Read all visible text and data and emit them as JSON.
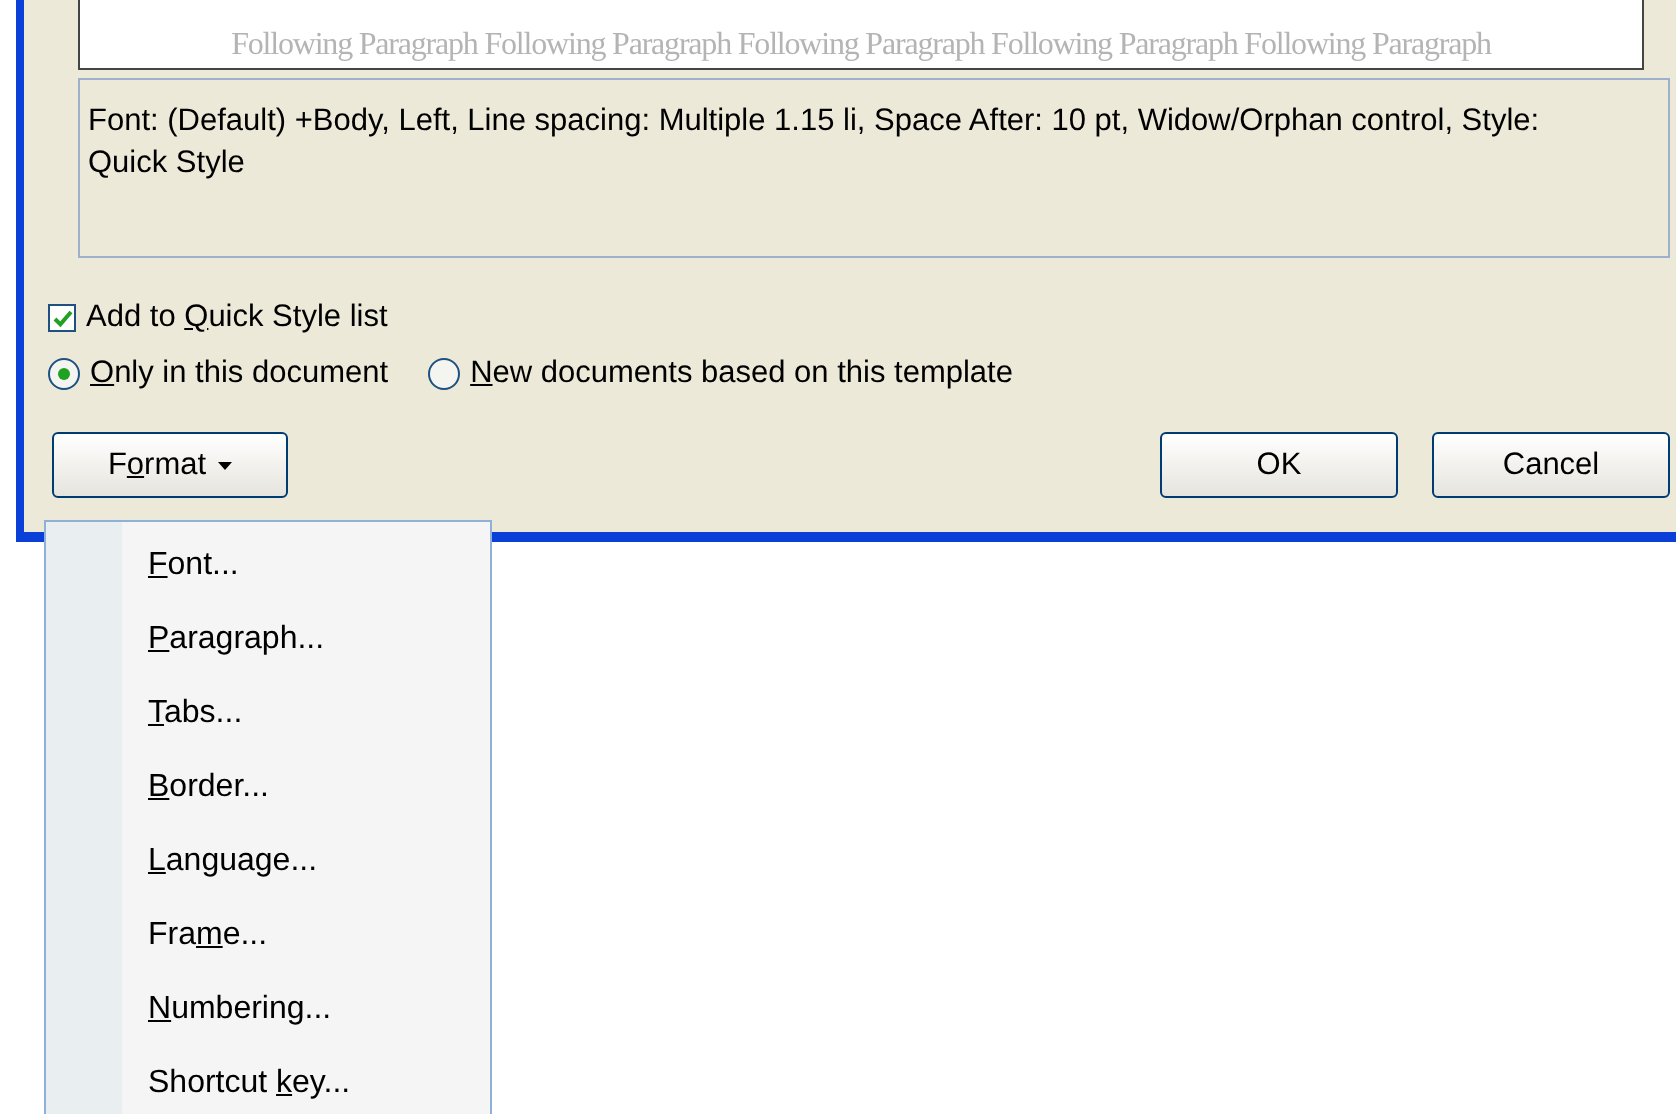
{
  "preview": {
    "following_text": "Following Paragraph Following Paragraph Following Paragraph Following Paragraph Following Paragraph"
  },
  "description": "Font: (Default) +Body, Left, Line spacing:  Multiple 1.15 li, Space After:  10 pt, Widow/Orphan control, Style: Quick Style",
  "add_to_quick_style": {
    "pre": "Add to ",
    "key": "Q",
    "post": "uick Style list",
    "checked": true
  },
  "scope_options": [
    {
      "key": "O",
      "post": "nly in this document",
      "selected": true
    },
    {
      "key": "N",
      "post": "ew documents based on this template",
      "selected": false
    }
  ],
  "format_button": {
    "pre": "F",
    "key": "o",
    "post": "rmat"
  },
  "buttons": [
    "OK",
    "Cancel"
  ],
  "format_menu": [
    {
      "key": "F",
      "post": "ont..."
    },
    {
      "key": "P",
      "post": "aragraph..."
    },
    {
      "key": "T",
      "post": "abs..."
    },
    {
      "key": "B",
      "post": "order..."
    },
    {
      "key": "L",
      "post": "anguage..."
    },
    {
      "pre": "Fra",
      "key": "m",
      "post": "e..."
    },
    {
      "key": "N",
      "post": "umbering..."
    },
    {
      "pre": "Shortcut ",
      "key": "k",
      "post": "ey..."
    }
  ]
}
